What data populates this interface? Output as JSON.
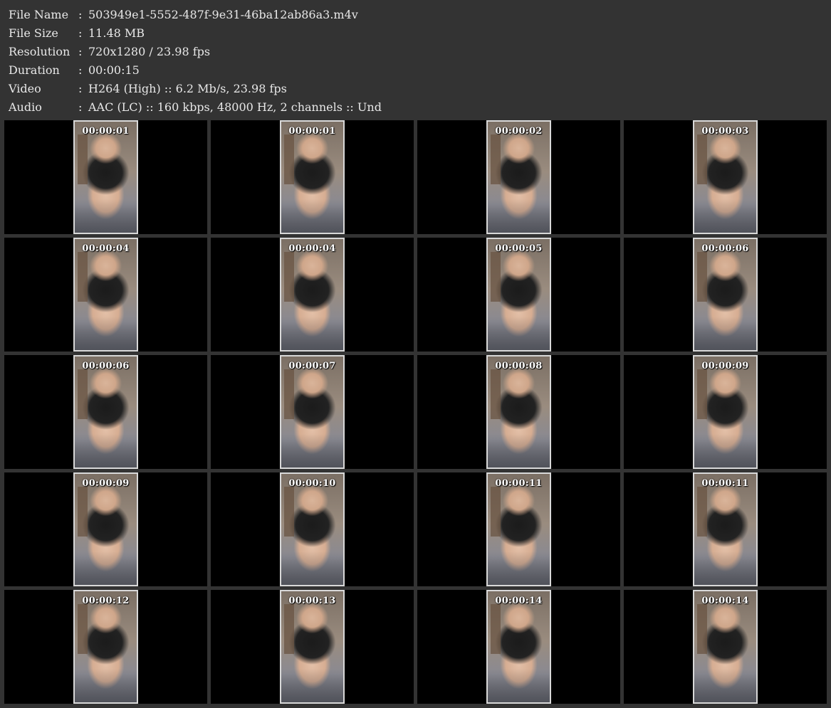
{
  "info": [
    {
      "label": "File Name",
      "value": "503949e1-5552-487f-9e31-46ba12ab86a3.m4v"
    },
    {
      "label": "File Size",
      "value": "11.48 MB"
    },
    {
      "label": "Resolution",
      "value": "720x1280 / 23.98 fps"
    },
    {
      "label": "Duration",
      "value": "00:00:15"
    },
    {
      "label": "Video",
      "value": "H264 (High) :: 6.2 Mb/s, 23.98 fps"
    },
    {
      "label": "Audio",
      "value": "AAC (LC) :: 160 kbps, 48000 Hz, 2 channels :: Und"
    }
  ],
  "separator": ":",
  "thumbnails": [
    "00:00:01",
    "00:00:01",
    "00:00:02",
    "00:00:03",
    "00:00:04",
    "00:00:04",
    "00:00:05",
    "00:00:06",
    "00:00:06",
    "00:00:07",
    "00:00:08",
    "00:00:09",
    "00:00:09",
    "00:00:10",
    "00:00:11",
    "00:00:11",
    "00:00:12",
    "00:00:13",
    "00:00:14",
    "00:00:14"
  ]
}
